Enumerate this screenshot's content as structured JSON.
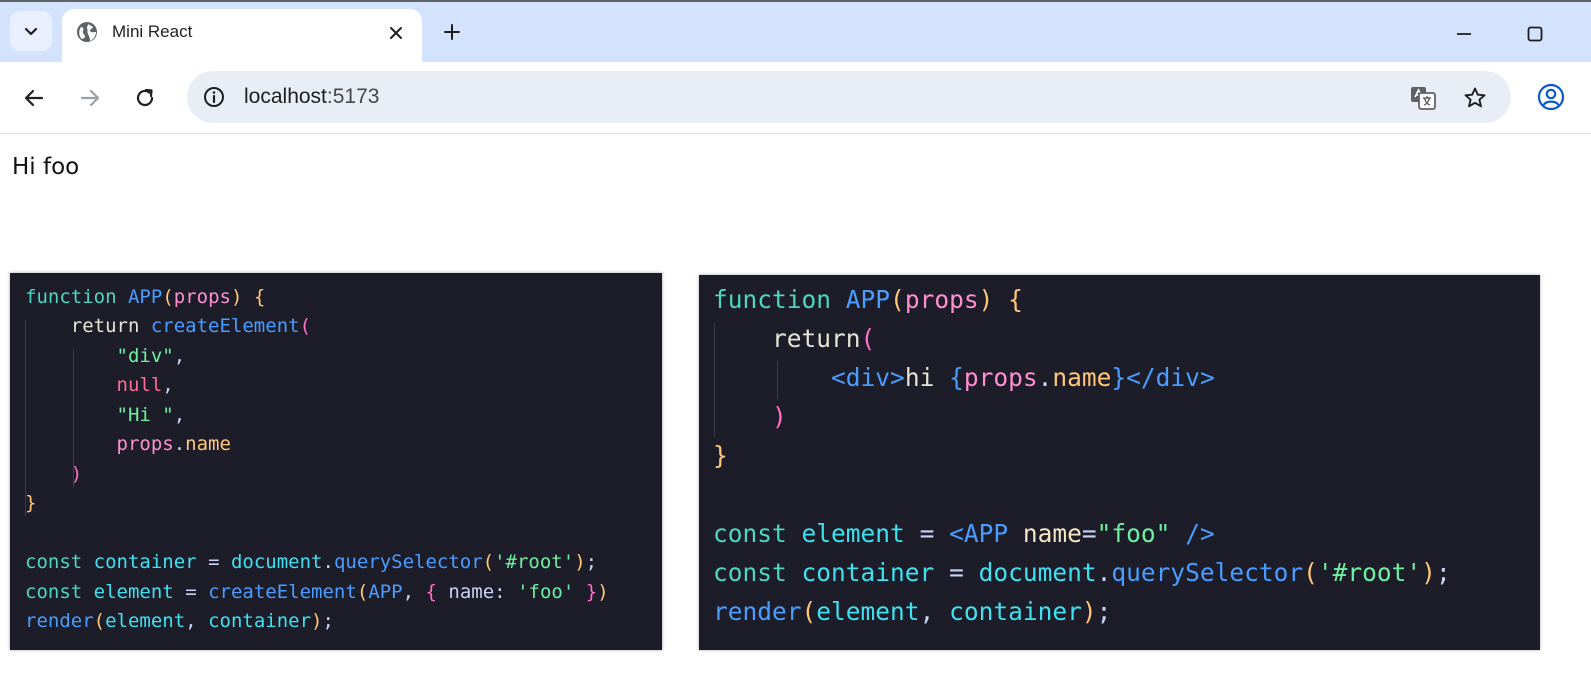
{
  "browser": {
    "tab_title": "Mini React",
    "url_host": "localhost",
    "url_port": ":5173"
  },
  "page": {
    "rendered_text": "Hi foo"
  },
  "code_left": {
    "l1_kw": "function",
    "l1_fn": "APP",
    "l1_param": "props",
    "l2_kw": "return",
    "l2_fn": "createElement",
    "l3_str": "\"div\"",
    "l4_null": "null",
    "l5_str": "\"Hi \"",
    "l6_obj": "props",
    "l6_prop": "name",
    "l9_kw": "const",
    "l9_var": "container",
    "l9_obj": "document",
    "l9_method": "querySelector",
    "l9_arg": "'#root'",
    "l10_kw": "const",
    "l10_var": "element",
    "l10_fn": "createElement",
    "l10_arg1": "APP",
    "l10_key": "name",
    "l10_val": "'foo'",
    "l11_fn": "render",
    "l11_arg1": "element",
    "l11_arg2": "container"
  },
  "code_right": {
    "l1_kw": "function",
    "l1_fn": "APP",
    "l1_param": "props",
    "l2_kw": "return",
    "l3_tag_open": "div",
    "l3_text": "hi ",
    "l3_obj": "props",
    "l3_prop": "name",
    "l3_tag_close": "div",
    "l7_kw": "const",
    "l7_var": "element",
    "l7_component": "APP",
    "l7_attr": "name",
    "l7_attr_val": "\"foo\"",
    "l8_kw": "const",
    "l8_var": "container",
    "l8_obj": "document",
    "l8_method": "querySelector",
    "l8_arg": "'#root'",
    "l9_fn": "render",
    "l9_arg1": "element",
    "l9_arg2": "container"
  },
  "colors": {
    "tab_strip": "#d3e3fd",
    "omnibox": "#e9eef6",
    "code_bg": "#1c1d29"
  },
  "icons": [
    "tab-search-icon",
    "globe-icon",
    "close-icon",
    "plus-icon",
    "minimize-icon",
    "maximize-icon",
    "back-arrow-icon",
    "forward-arrow-icon",
    "reload-icon",
    "info-icon",
    "translate-icon",
    "star-icon",
    "profile-icon"
  ]
}
